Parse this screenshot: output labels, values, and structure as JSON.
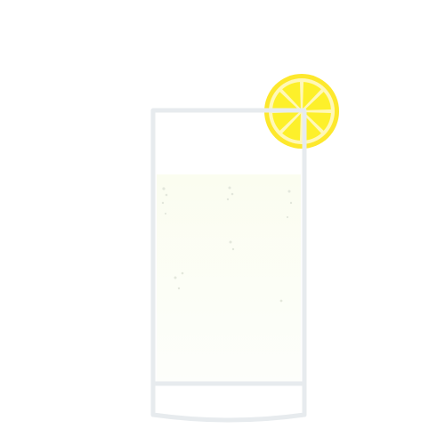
{
  "illustration": {
    "subject": "highball-glass-with-lemon-slice",
    "colors": {
      "background": "#ffffff",
      "glass_outline": "#e7ebee",
      "drink_top": "#fbfdf0",
      "drink_bottom": "#fdfefb",
      "bubbles": "#e3e7dc",
      "lemon_rind": "#fde82c",
      "lemon_pith": "#fff8b8",
      "lemon_flesh": "#fdf02a"
    },
    "lemon_segment_count": 8,
    "bubble_count": 16,
    "icons": [
      "highball-glass-icon",
      "lemon-slice-icon",
      "soda-bubbles-icon"
    ]
  }
}
